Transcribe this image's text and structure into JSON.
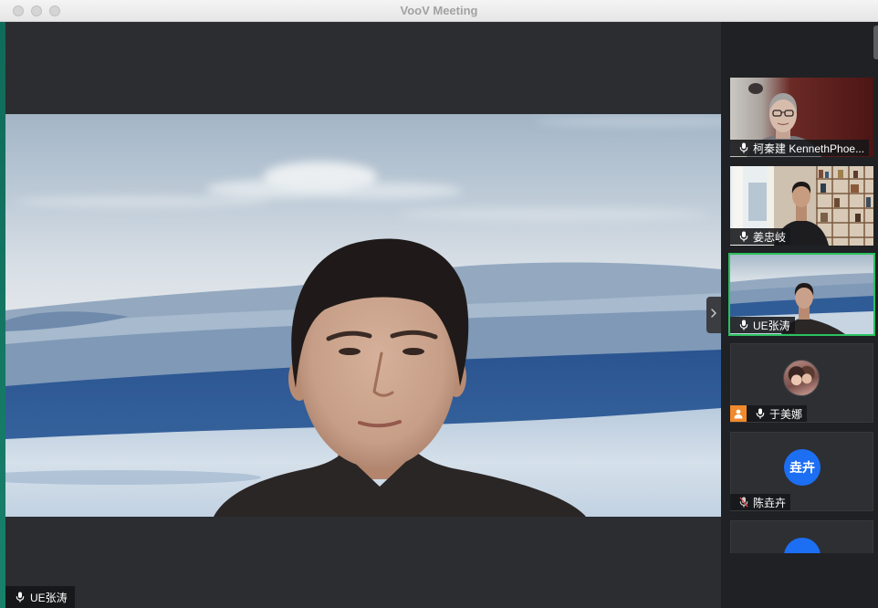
{
  "window": {
    "title": "VooV Meeting"
  },
  "main_video": {
    "participant_name": "UE张涛",
    "mic_icon": "mic-icon",
    "muted": false
  },
  "sidebar": {
    "collapse_icon": "chevron-right-icon",
    "participants": [
      {
        "name": "柯秦建 KennethPhoe...",
        "camera_on": true,
        "muted": false,
        "mic_icon": "mic-icon",
        "active_speaker": false
      },
      {
        "name": "姜忠岐",
        "camera_on": true,
        "muted": false,
        "mic_icon": "mic-icon",
        "active_speaker": false
      },
      {
        "name": "UE张涛",
        "camera_on": true,
        "muted": false,
        "mic_icon": "mic-icon",
        "active_speaker": true
      },
      {
        "name": "于美娜",
        "camera_on": false,
        "muted": false,
        "mic_icon": "mic-icon",
        "badge_icon": "user-icon",
        "active_speaker": false
      },
      {
        "name": "陈垚卉",
        "camera_on": false,
        "muted": true,
        "initials": "垚卉",
        "mic_icon": "mic-muted-icon",
        "active_speaker": false
      },
      {
        "camera_on": false,
        "active_speaker": false
      }
    ]
  },
  "colors": {
    "active_speaker_border": "#2ac15f",
    "avatar_blue": "#1c6ef2",
    "badge_orange": "#f08a2c",
    "mute_red": "#e5484d"
  }
}
